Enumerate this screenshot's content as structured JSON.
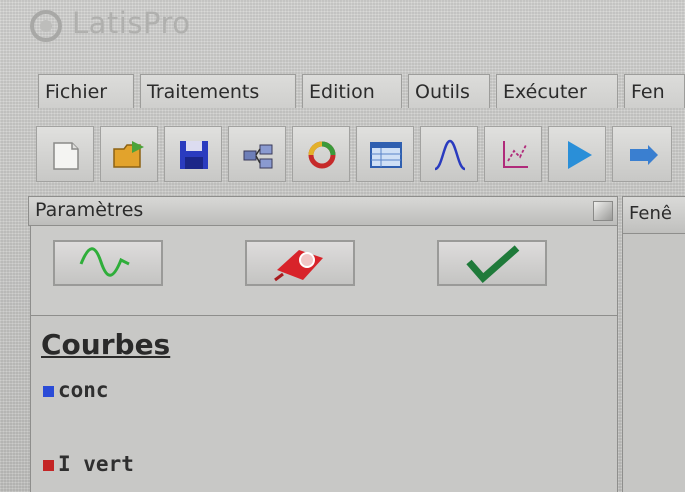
{
  "window": {
    "title": "LatisPro"
  },
  "menubar": {
    "items": [
      {
        "label": "Fichier"
      },
      {
        "label": "Traitements"
      },
      {
        "label": "Edition"
      },
      {
        "label": "Outils"
      },
      {
        "label": "Exécuter"
      },
      {
        "label": "Fen"
      }
    ]
  },
  "toolbar": {
    "buttons": [
      {
        "icon": "new-document-icon"
      },
      {
        "icon": "open-folder-icon"
      },
      {
        "icon": "save-icon"
      },
      {
        "icon": "network-icon"
      },
      {
        "icon": "color-wheel-icon"
      },
      {
        "icon": "table-window-icon"
      },
      {
        "icon": "curve-icon"
      },
      {
        "icon": "axes-icon"
      },
      {
        "icon": "play-icon"
      },
      {
        "icon": "arrow-icon"
      }
    ]
  },
  "parameters": {
    "title": "Paramètres",
    "buttons": [
      {
        "icon": "sine-wave-icon"
      },
      {
        "icon": "eraser-icon"
      },
      {
        "icon": "checkmark-icon"
      }
    ]
  },
  "curves": {
    "title": "Courbes",
    "items": [
      {
        "label": "conc",
        "color": "#2a4bd7"
      },
      {
        "label": "I vert",
        "color": "#c42525"
      }
    ]
  },
  "right_window": {
    "tab_label": "Fenê"
  }
}
